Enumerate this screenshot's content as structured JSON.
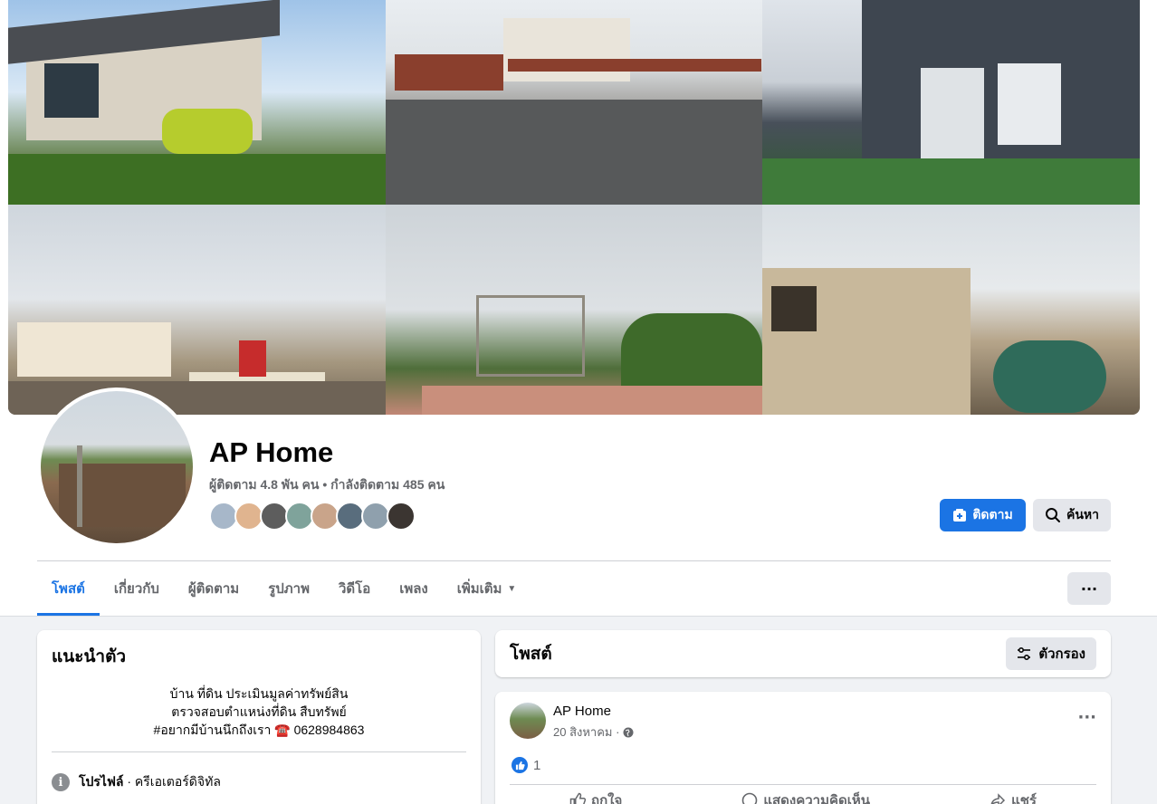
{
  "page": {
    "name": "AP Home",
    "stats": "ผู้ติดตาม 4.8 พัน คน • กำลังติดตาม 485 คน",
    "follow_label": "ติดตาม",
    "search_label": "ค้นหา",
    "more_label": "···"
  },
  "tabs": [
    {
      "label": "โพสต์"
    },
    {
      "label": "เกี่ยวกับ"
    },
    {
      "label": "ผู้ติดตาม"
    },
    {
      "label": "รูปภาพ"
    },
    {
      "label": "วิดีโอ"
    },
    {
      "label": "เพลง"
    },
    {
      "label": "เพิ่มเติม"
    }
  ],
  "intro": {
    "title": "แนะนำตัว",
    "bio_line1": "บ้าน ที่ดิน ประเมินมูลค่าทรัพย์สิน",
    "bio_line2": "ตรวจสอบตำแหน่งที่ดิน สืบทรัพย์",
    "bio_line3": "#อยากมีบ้านนึกถึงเรา ☎️ 0628984863",
    "profile_label": "โปรไฟล์",
    "profile_category": " · ครีเอเตอร์ดิจิทัล"
  },
  "posts_header": {
    "title": "โพสต์",
    "filter_label": "ตัวกรอง"
  },
  "post": {
    "author": "AP Home",
    "date": "20 สิงหาคม ·",
    "like_count": "1",
    "like_label": "ถูกใจ",
    "comment_label": "แสดงความคิดเห็น",
    "share_label": "แชร์"
  },
  "colors": {
    "accent": "#1b74e4",
    "background": "#f0f2f5",
    "secondary_text": "#65676b"
  }
}
